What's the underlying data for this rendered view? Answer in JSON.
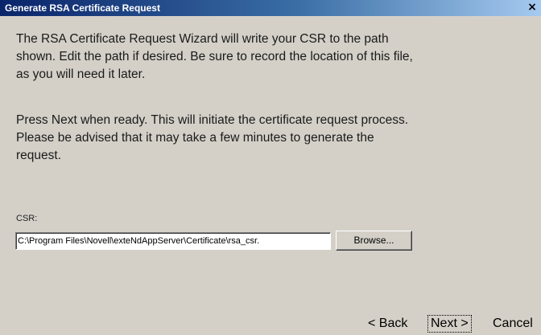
{
  "window": {
    "title": "Generate RSA Certificate Request",
    "close_glyph": "×"
  },
  "body": {
    "paragraph1": "The RSA Certificate Request Wizard will write your CSR to the path\nshown. Edit the path if desired.  Be sure to record the location of this file,\nas you will need it later.",
    "paragraph2": "Press Next when ready.  This will initiate the certificate request process.\nPlease be advised that it may take a few minutes to generate the\nrequest."
  },
  "csr": {
    "label": "CSR:",
    "value": "C:\\Program Files\\Novell\\exteNdAppServer\\Certificate\\rsa_csr.",
    "browse_label": "Browse..."
  },
  "buttons": {
    "back": "< Back",
    "next": "Next >",
    "cancel": "Cancel"
  }
}
